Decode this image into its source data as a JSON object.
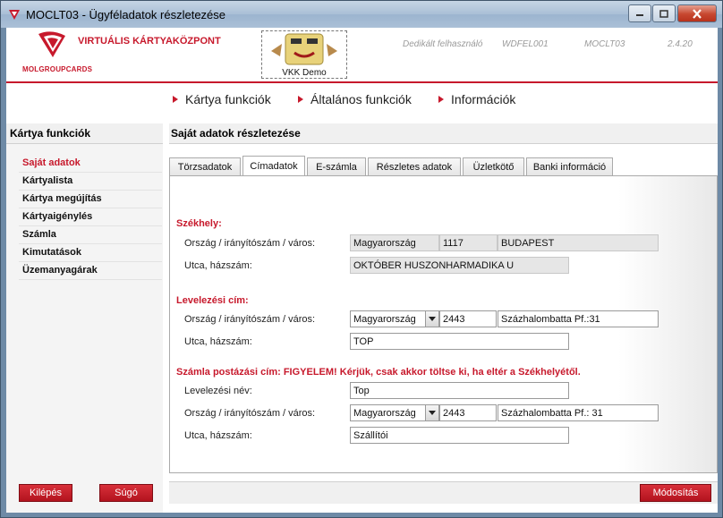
{
  "window": {
    "title": "MOCLT03 - Ügyféladatok részletezése"
  },
  "header": {
    "company": "MOLGROUPCARDS",
    "app_name": "VIRTUÁLIS KÁRTYAKÖZPONT",
    "demo_label": "VKK Demo",
    "user_label": "Dedikált felhasználó",
    "user_id": "WDFEL001",
    "screen_code": "MOCLT03",
    "version": "2.4.20"
  },
  "topnav": [
    {
      "label": "Kártya funkciók"
    },
    {
      "label": "Általános funkciók"
    },
    {
      "label": "Információk"
    }
  ],
  "sidebar": {
    "title": "Kártya funkciók",
    "items": [
      {
        "label": "Saját adatok",
        "active": true
      },
      {
        "label": "Kártyalista"
      },
      {
        "label": "Kártya megújítás"
      },
      {
        "label": "Kártyaigénylés"
      },
      {
        "label": "Számla"
      },
      {
        "label": "Kimutatások"
      },
      {
        "label": "Üzemanyagárak"
      }
    ],
    "exit_label": "Kilépés",
    "help_label": "Súgó"
  },
  "main": {
    "title": "Saját adatok részletezése",
    "tabs": [
      {
        "label": "Törzsadatok"
      },
      {
        "label": "Címadatok",
        "active": true
      },
      {
        "label": "E-számla"
      },
      {
        "label": "Részletes adatok"
      },
      {
        "label": "Üzletkötő"
      },
      {
        "label": "Banki információ"
      }
    ],
    "seat": {
      "title": "Székhely:",
      "country_label": "Ország / irányítószám / város:",
      "country": "Magyarország",
      "zip": "1117",
      "city": "BUDAPEST",
      "street_label": "Utca, házszám:",
      "street": "OKTÓBER HUSZONHARMADIKA U"
    },
    "mail": {
      "title": "Levelezési cím:",
      "country_label": "Ország / irányítószám / város:",
      "country": "Magyarország",
      "zip": "2443",
      "city": "Százhalombatta Pf.:31",
      "street_label": "Utca, házszám:",
      "street": "TOP"
    },
    "invoice": {
      "title": "Számla postázási cím: FIGYELEM! Kérjük, csak akkor töltse ki, ha eltér a Székhelyétől.",
      "name_label": "Levelezési név:",
      "name": "Top",
      "country_label": "Ország / irányítószám / város:",
      "country": "Magyarország",
      "zip": "2443",
      "city": "Százhalombatta Pf.: 31",
      "street_label": "Utca, házszám:",
      "street": "Szállítói"
    },
    "modify_label": "Módosítás"
  }
}
